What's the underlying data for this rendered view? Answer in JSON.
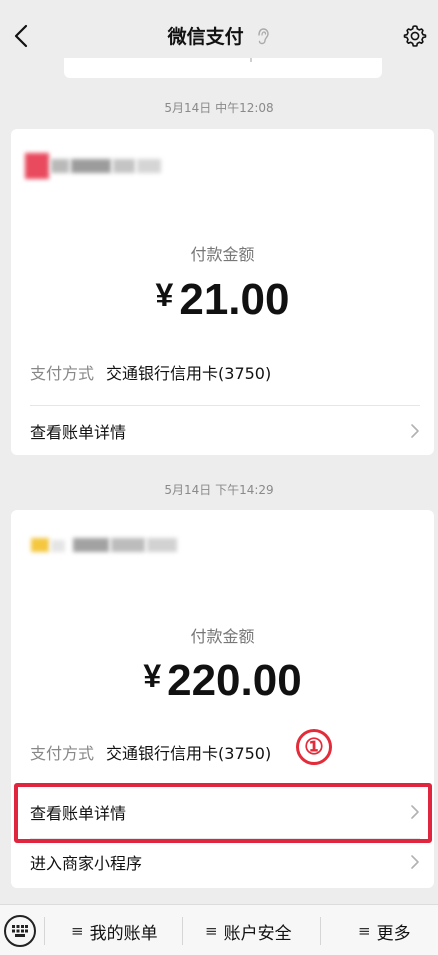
{
  "header": {
    "title": "微信支付"
  },
  "transactions": [
    {
      "timestamp": "5月14日 中午12:08",
      "amount_label": "付款金额",
      "currency_symbol": "¥",
      "amount": "21.00",
      "pay_method_label": "支付方式",
      "pay_method_value": "交通银行信用卡(3750)",
      "bill_detail_label": "查看账单详情"
    },
    {
      "timestamp": "5月14日 下午14:29",
      "amount_label": "付款金额",
      "currency_symbol": "¥",
      "amount": "220.00",
      "pay_method_label": "支付方式",
      "pay_method_value": "交通银行信用卡(3750)",
      "step_marker": "①",
      "bill_detail_label": "查看账单详情",
      "mini_program_label": "进入商家小程序"
    }
  ],
  "bottom_bar": {
    "items": [
      {
        "label": "我的账单"
      },
      {
        "label": "账户安全"
      },
      {
        "label": "更多"
      }
    ]
  },
  "colors": {
    "highlight": "#e0263f",
    "background": "#ededed"
  },
  "icons": [
    "back-arrow-icon",
    "ear-icon",
    "gear-icon",
    "chevron-right-icon",
    "keyboard-icon",
    "menu-icon"
  ]
}
